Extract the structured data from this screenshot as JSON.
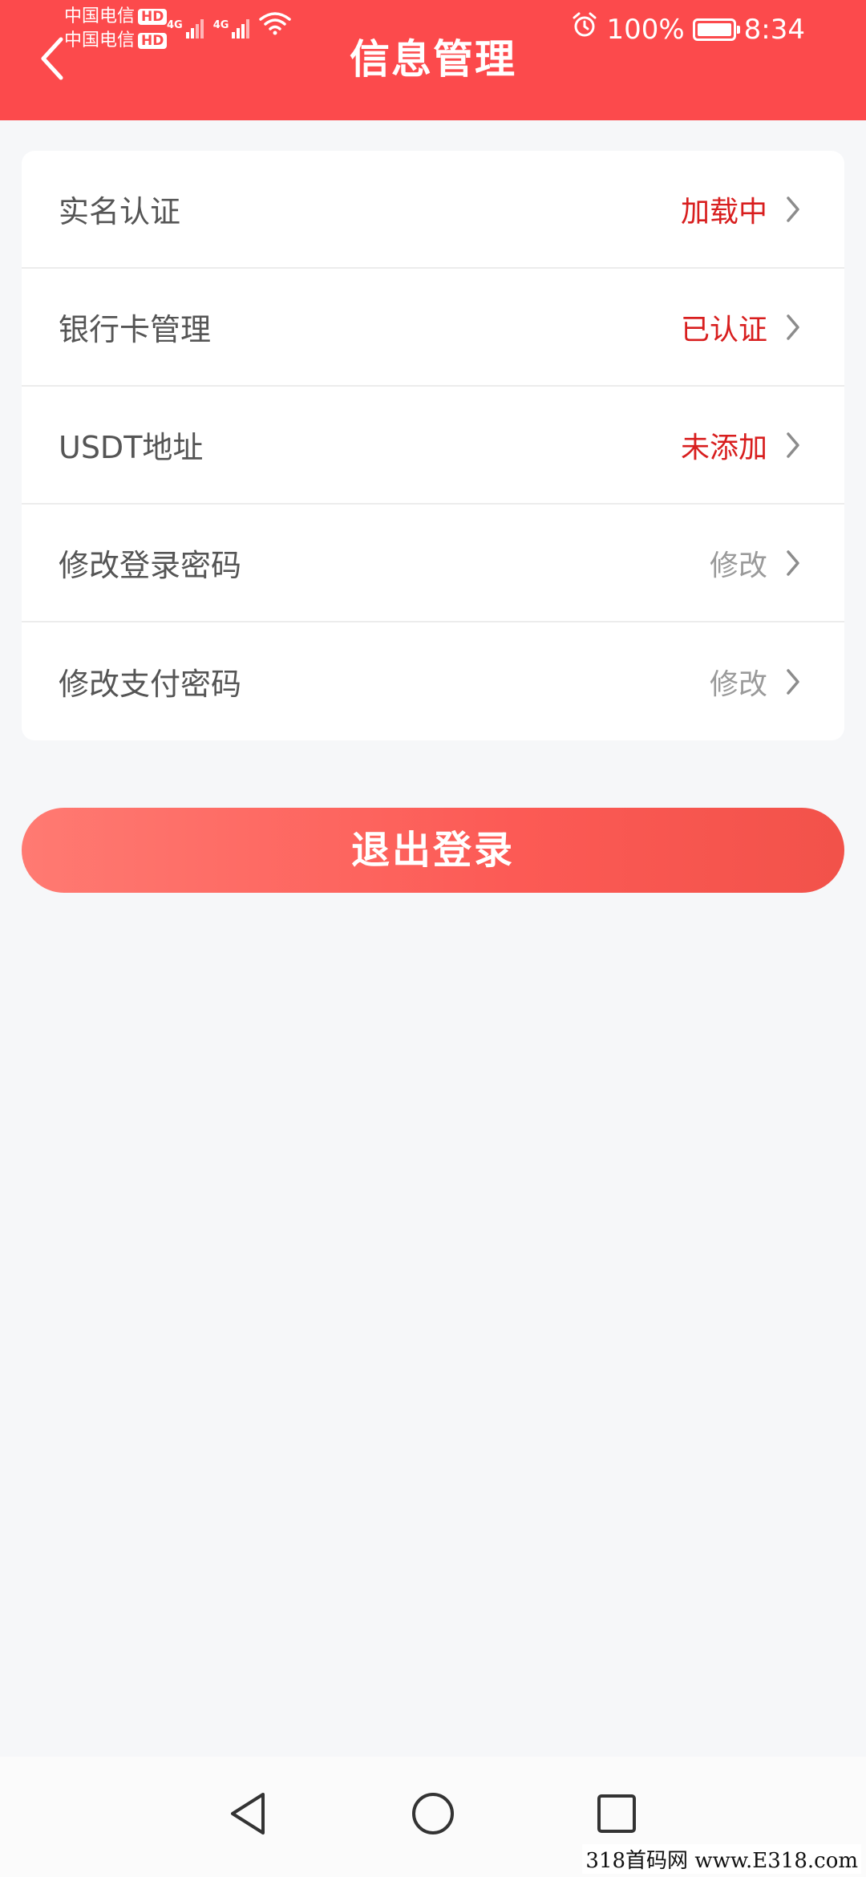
{
  "status_bar": {
    "carriers": [
      {
        "name": "中国电信",
        "badge": "HD"
      },
      {
        "name": "中国电信",
        "badge": "HD"
      }
    ],
    "network_labels": [
      "4G",
      "4G"
    ],
    "battery_percent": "100%",
    "battery_level": 1.0,
    "time": "8:34"
  },
  "header": {
    "title": "信息管理",
    "background_color": "#fc4a4c"
  },
  "menu": {
    "items": [
      {
        "label": "实名认证",
        "status": "加载中",
        "status_color": "#d81e1e"
      },
      {
        "label": "银行卡管理",
        "status": "已认证",
        "status_color": "#d81e1e"
      },
      {
        "label": "USDT地址",
        "status": "未添加",
        "status_color": "#d81e1e"
      },
      {
        "label": "修改登录密码",
        "status": "修改",
        "status_color": "#9a9a9a"
      },
      {
        "label": "修改支付密码",
        "status": "修改",
        "status_color": "#9a9a9a"
      }
    ]
  },
  "logout": {
    "label": "退出登录"
  },
  "nav_bar": {
    "icons": [
      "back-triangle-icon",
      "home-circle-icon",
      "recents-square-icon"
    ]
  },
  "watermark": {
    "text": "318首码网 www.E318.com"
  }
}
